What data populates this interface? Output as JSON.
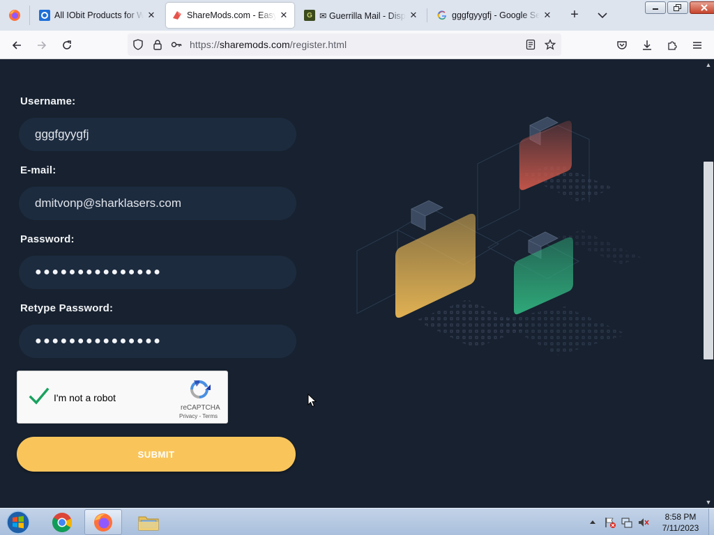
{
  "browser": {
    "tabs": [
      {
        "title": "All IObit Products for Wi",
        "favicon": "iobit-icon",
        "active": false
      },
      {
        "title": "ShareMods.com - Easy w",
        "favicon": "sharemods-icon",
        "active": true
      },
      {
        "title": "✉ Guerrilla Mail - Dispos",
        "favicon": "guerrilla-mail-icon",
        "active": false
      },
      {
        "title": "gggfgyygfj - Google Sear",
        "favicon": "google-icon",
        "active": false
      }
    ],
    "url_prefix": "https://",
    "url_host": "sharemods.com",
    "url_path": "/register.html"
  },
  "form": {
    "username_label": "Username:",
    "username_value": "gggfgyygfj",
    "email_label": "E-mail:",
    "email_value": "dmitvonp@sharklasers.com",
    "password_label": "Password:",
    "password_value": "●●●●●●●●●●●●●●●",
    "retype_label": "Retype Password:",
    "retype_value": "●●●●●●●●●●●●●●●",
    "submit_label": "SUBMIT"
  },
  "recaptcha": {
    "checked": true,
    "label": "I'm not a robot",
    "brand": "reCAPTCHA",
    "privacy": "Privacy",
    "sep": " - ",
    "terms": "Terms"
  },
  "taskbar": {
    "apps": [
      "windows-start",
      "chrome",
      "firefox",
      "file-explorer"
    ],
    "time": "8:58 PM",
    "date": "7/11/2023"
  },
  "colors": {
    "page_bg": "#17212f",
    "field_bg": "#1d2b3f",
    "submit_bg": "#f9c55b",
    "tile_red": "#c8574a",
    "tile_yellow": "#e0b153",
    "tile_green": "#2fa879"
  }
}
